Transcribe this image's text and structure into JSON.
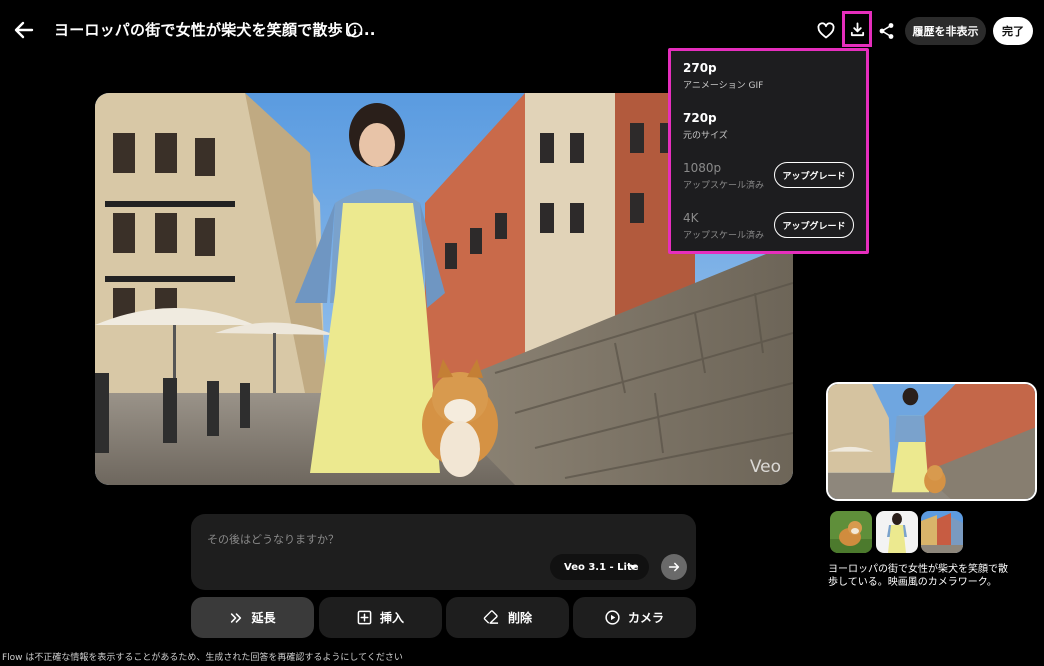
{
  "header": {
    "title": "ヨーロッパの街で女性が柴犬を笑顔で散歩し...",
    "hide_history_label": "履歴を非表示",
    "done_label": "完了"
  },
  "download_menu": {
    "items": [
      {
        "quality": "270p",
        "description": "アニメーション GIF",
        "enabled": true
      },
      {
        "quality": "720p",
        "description": "元のサイズ",
        "enabled": true
      },
      {
        "quality": "1080p",
        "description": "アップスケール済み",
        "enabled": false,
        "action_label": "アップグレード"
      },
      {
        "quality": "4K",
        "description": "アップスケール済み",
        "enabled": false,
        "action_label": "アップグレード"
      }
    ]
  },
  "video": {
    "watermark": "Veo"
  },
  "prompt": {
    "placeholder": "その後はどうなりますか？",
    "model": "Veo 3.1 - Lite"
  },
  "actions": [
    {
      "label": "延長",
      "icon": "double-chevron-right-icon",
      "active": true
    },
    {
      "label": "挿入",
      "icon": "plus-square-icon",
      "active": false
    },
    {
      "label": "削除",
      "icon": "eraser-icon",
      "active": false
    },
    {
      "label": "カメラ",
      "icon": "play-circle-icon",
      "active": false
    }
  ],
  "sidebar": {
    "caption": "ヨーロッパの街で女性が柴犬を笑顔で散歩している。映画風のカメラワーク。"
  },
  "footer": {
    "disclaimer": "Flow は不正確な情報を表示することがあるため、生成された回答を再確認するようにしてください"
  },
  "colors": {
    "highlight": "#e62ebd",
    "background": "#000000",
    "panel": "#1e1e1e"
  }
}
